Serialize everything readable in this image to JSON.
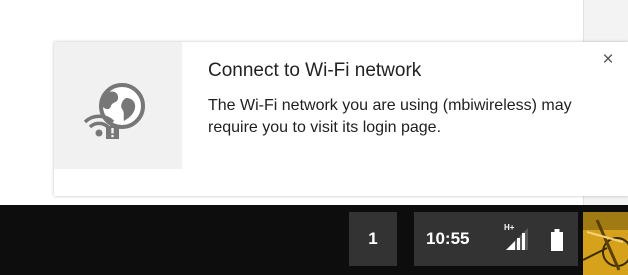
{
  "notification": {
    "title": "Connect to Wi-Fi network",
    "message": "The Wi-Fi network you are using (mbiwireless) may require you to visit its login page.",
    "close_glyph": "×",
    "icon": "wifi-globe-warning-icon"
  },
  "shelf": {
    "notification_count": "1",
    "clock": "10:55",
    "signal_label": "H+",
    "signal_icon": "cellular-signal-icon",
    "battery_icon": "battery-icon",
    "avatar": "user-avatar"
  },
  "colors": {
    "shelf_background": "#0d0d0d",
    "tray_button": "#333333",
    "icon_area": "#f1f1f1",
    "icon_gray": "#777777"
  }
}
